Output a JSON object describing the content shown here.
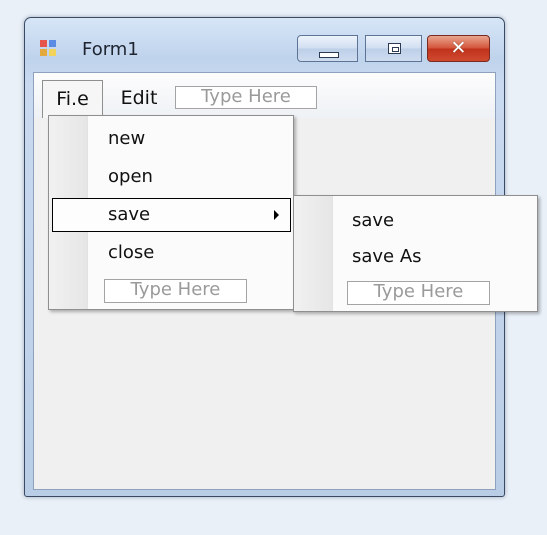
{
  "window": {
    "title": "Form1"
  },
  "menubar": {
    "items": [
      {
        "label": "Fi.e"
      },
      {
        "label": "Edit"
      }
    ],
    "type_here": "Type Here"
  },
  "file_menu": {
    "items": [
      {
        "label": "new"
      },
      {
        "label": "open"
      },
      {
        "label": "save",
        "selected": true,
        "has_submenu": true
      },
      {
        "label": "close"
      }
    ],
    "type_here": "Type Here"
  },
  "save_submenu": {
    "items": [
      {
        "label": "save"
      },
      {
        "label": "save As"
      }
    ],
    "type_here": "Type Here"
  },
  "colors": {
    "close_button": "#c0321c",
    "title_bar": "#bfd3ec",
    "client_background": "#f0f0f0"
  }
}
